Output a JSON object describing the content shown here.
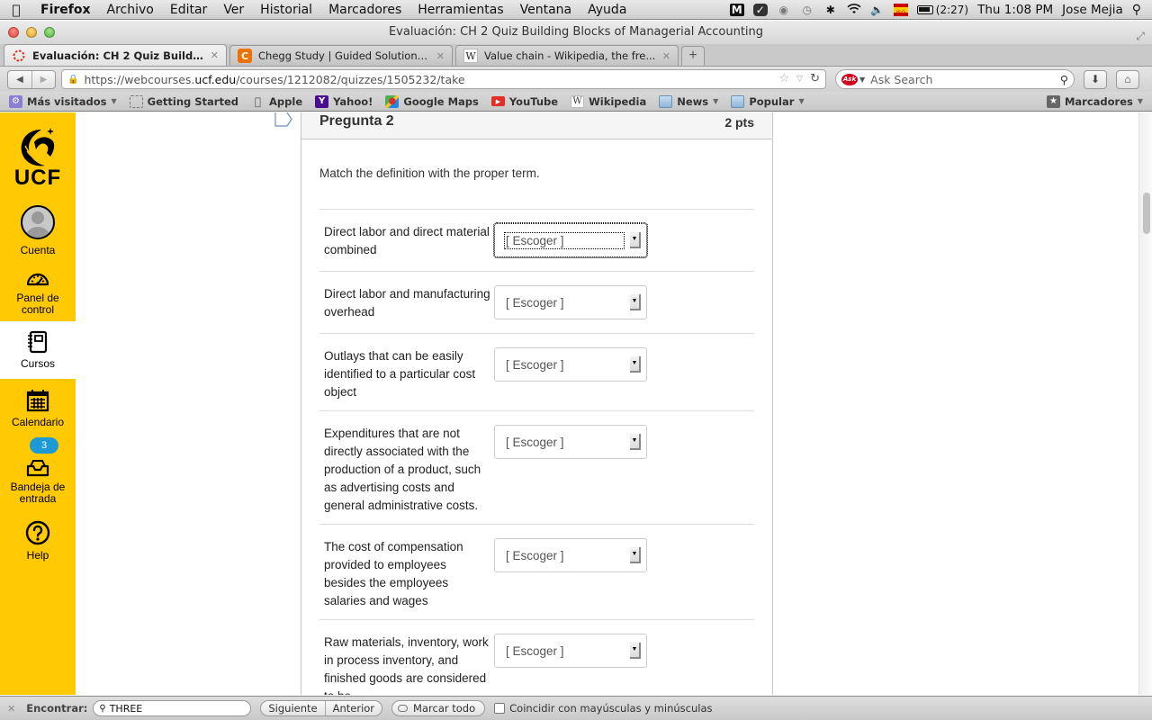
{
  "macos_menubar": {
    "apple_icon": "apple-logo-icon",
    "app_name": "Firefox",
    "menus": [
      "Archivo",
      "Editar",
      "Ver",
      "Historial",
      "Marcadores",
      "Herramientas",
      "Ventana",
      "Ayuda"
    ],
    "battery": "(2:27)",
    "clock": "Thu 1:08 PM",
    "user": "Jose Mejia",
    "input_source": "ISO"
  },
  "window": {
    "title": "Evaluación: CH 2 Quiz Building Blocks of Managerial Accounting"
  },
  "tabs": [
    {
      "label": "Evaluación: CH 2 Quiz Building ...",
      "icon": "canvas-ring-icon",
      "active": true
    },
    {
      "label": "Chegg Study | Guided Solutions...",
      "icon": "chegg-icon",
      "active": false
    },
    {
      "label": "Value chain - Wikipedia, the fre...",
      "icon": "wikipedia-icon",
      "active": false
    }
  ],
  "navbar": {
    "url_prefix": "https://webcourses.",
    "url_domain": "ucf.edu",
    "url_suffix": "/courses/1212082/quizzes/1505232/take",
    "search_placeholder": "Ask Search",
    "search_engine_badge": "Ask"
  },
  "bookmarks": {
    "items": [
      {
        "label": "Más visitados",
        "icon": "most-visited-icon",
        "dropdown": true
      },
      {
        "label": "Getting Started",
        "icon": "dotted-page-icon",
        "dropdown": false
      },
      {
        "label": "Apple",
        "icon": "apple-icon",
        "dropdown": false
      },
      {
        "label": "Yahoo!",
        "icon": "yahoo-icon",
        "dropdown": false
      },
      {
        "label": "Google Maps",
        "icon": "google-maps-icon",
        "dropdown": false
      },
      {
        "label": "YouTube",
        "icon": "youtube-icon",
        "dropdown": false
      },
      {
        "label": "Wikipedia",
        "icon": "wikipedia-icon",
        "dropdown": false
      },
      {
        "label": "News",
        "icon": "folder-icon",
        "dropdown": true
      },
      {
        "label": "Popular",
        "icon": "folder-icon",
        "dropdown": true
      }
    ],
    "right_label": "Marcadores"
  },
  "sidebar": {
    "logo_text": "UCF",
    "brand_color": "#ffc904",
    "items": [
      {
        "label": "Cuenta",
        "icon": "account-avatar-icon"
      },
      {
        "label": "Panel de control",
        "icon": "dashboard-gauge-icon"
      },
      {
        "label": "Cursos",
        "icon": "courses-notebook-icon",
        "active": true
      },
      {
        "label": "Calendario",
        "icon": "calendar-icon"
      },
      {
        "label": "Bandeja de entrada",
        "icon": "inbox-tray-icon",
        "badge": "3"
      },
      {
        "label": "Help",
        "icon": "help-question-icon"
      }
    ]
  },
  "question": {
    "title": "Pregunta 2",
    "points": "2 pts",
    "prompt": "Match the definition with the proper term.",
    "rows": [
      {
        "definition": "Direct labor and direct material combined",
        "selected": "[ Escoger ]",
        "focused": true
      },
      {
        "definition": "Direct labor and manufacturing overhead",
        "selected": "[ Escoger ]"
      },
      {
        "definition": "Outlays that can be easily identified to a particular cost object",
        "selected": "[ Escoger ]"
      },
      {
        "definition": "Expenditures that are not directly associated with the production of a product, such as advertising costs and general administrative costs.",
        "selected": "[ Escoger ]"
      },
      {
        "definition": "The cost of compensation provided to employees besides the employees salaries and wages",
        "selected": "[ Escoger ]"
      },
      {
        "definition": "Raw materials, inventory, work in process inventory, and finished goods are considered to be",
        "selected": "[ Escoger ]"
      }
    ]
  },
  "findbar": {
    "label": "Encontrar:",
    "query": "THREE",
    "next": "Siguiente",
    "previous": "Anterior",
    "highlight_all": "Marcar todo",
    "match_case": "Coincidir con mayúsculas y minúsculas"
  }
}
